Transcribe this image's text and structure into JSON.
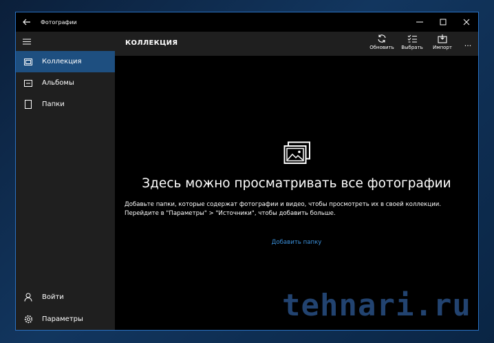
{
  "window": {
    "title": "Фотографии",
    "controls": [
      "minimize-icon",
      "maximize-icon",
      "close-icon"
    ]
  },
  "sidebar": {
    "items": [
      {
        "label": "Коллекция",
        "icon": "collection-icon",
        "active": true
      },
      {
        "label": "Альбомы",
        "icon": "album-icon",
        "active": false
      },
      {
        "label": "Папки",
        "icon": "folder-icon",
        "active": false
      }
    ],
    "bottom_items": [
      {
        "label": "Войти",
        "icon": "person-icon"
      },
      {
        "label": "Параметры",
        "icon": "gear-icon"
      }
    ]
  },
  "header": {
    "title": "КОЛЛЕКЦИЯ",
    "toolbar": [
      {
        "label": "Обновить",
        "icon": "refresh-icon"
      },
      {
        "label": "Выбрать",
        "icon": "select-icon"
      },
      {
        "label": "Импорт",
        "icon": "import-icon"
      }
    ],
    "more": "..."
  },
  "main": {
    "heading": "Здесь можно просматривать все фотографии",
    "description": "Добавьте папки, которые содержат фотографии и видео, чтобы просмотреть их в своей коллекции. Перейдите в \"Параметры\" > \"Источники\", чтобы добавить больше.",
    "link": "Добавить папку"
  },
  "watermark": "tehnari.ru",
  "colors": {
    "accent": "#1e4f80",
    "link": "#3b8fd9",
    "sidebar_bg": "#1f1f1f",
    "content_bg": "#000000"
  }
}
